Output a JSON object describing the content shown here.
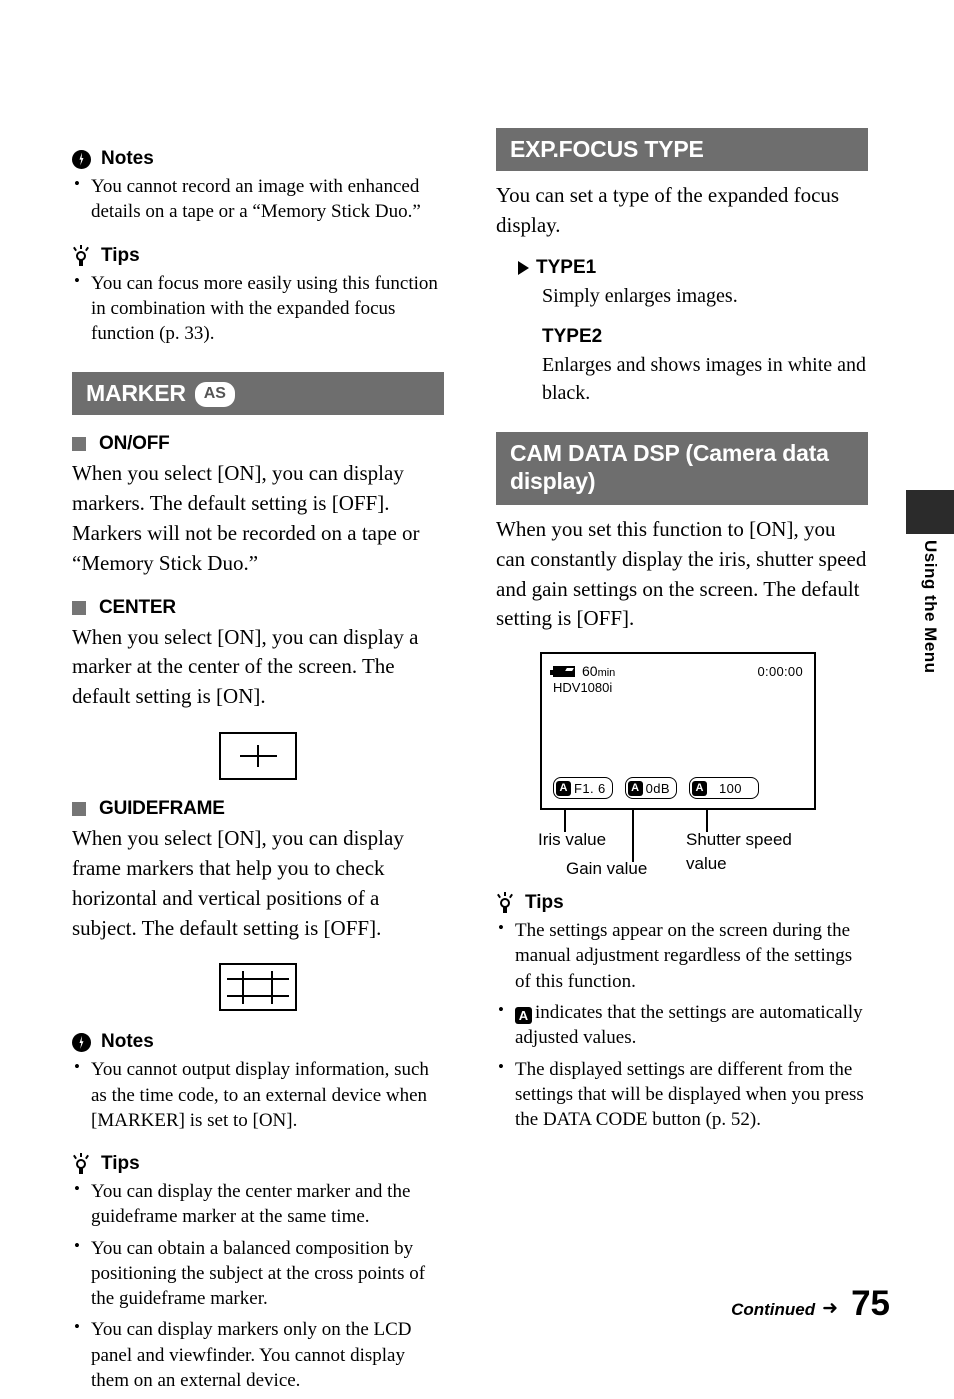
{
  "page": {
    "number": "75",
    "continued_label": "Continued",
    "continued_arrow": "➜",
    "side_tab_label": "Using the Menu"
  },
  "icons": {
    "notes": "notes-lightning-icon",
    "tips": "tips-lightbulb-icon",
    "square_bullet": "gray-square-bullet-icon",
    "triangle": "default-setting-triangle-icon",
    "battery": "battery-icon",
    "auto_badge": "auto-a-badge-icon"
  },
  "colors": {
    "header_bar": "#6e6e6e",
    "square_bullet": "#757575",
    "side_tab": "#2b2b2b"
  },
  "left_column": {
    "notes_top": {
      "heading": "Notes",
      "items": [
        "You cannot record an image with enhanced details on a tape or a “Memory Stick Duo.”"
      ]
    },
    "tips_top": {
      "heading": "Tips",
      "items": [
        "You can focus more easily using this function in combination with the expanded focus function (p. 33)."
      ]
    },
    "marker_section": {
      "title": "MARKER",
      "badge": "AS",
      "subsections": [
        {
          "heading": "ON/OFF",
          "body": "When you select [ON], you can display markers. The default setting is [OFF]. Markers will not be recorded on a tape or “Memory Stick Duo.”"
        },
        {
          "heading": "CENTER",
          "body": "When you select [ON], you can display a marker at the center of the screen. The default setting is [ON].",
          "figure": "center-marker-figure"
        },
        {
          "heading": "GUIDEFRAME",
          "body": "When you select [ON], you can display frame markers that help you to check horizontal and vertical positions of a subject. The default setting is [OFF].",
          "figure": "guideframe-marker-figure"
        }
      ]
    },
    "notes_bottom": {
      "heading": "Notes",
      "items": [
        "You cannot output display information, such as the time code, to an external device when [MARKER] is set to [ON]."
      ]
    },
    "tips_bottom": {
      "heading": "Tips",
      "items": [
        "You can display the center marker and the guideframe marker at the same time.",
        "You can obtain a balanced composition by positioning the subject at the cross points of the guideframe marker.",
        "You can display markers only on the LCD panel and viewfinder. You cannot display them on an external device."
      ]
    }
  },
  "right_column": {
    "exp_focus_section": {
      "title": "EXP.FOCUS TYPE",
      "body": "You can set a type of the expanded focus display.",
      "options": [
        {
          "label": "TYPE1",
          "is_default": true,
          "body": "Simply enlarges images."
        },
        {
          "label": "TYPE2",
          "is_default": false,
          "body": "Enlarges and shows images in white and black."
        }
      ]
    },
    "cam_data_section": {
      "title": "CAM DATA DSP (Camera data display)",
      "body": "When you set this function to [ON], you can constantly display the iris, shutter speed and gain settings on the screen. The default setting is [OFF].",
      "lcd": {
        "battery_minutes": "60",
        "battery_unit": "min",
        "timecode": "0:00:00",
        "format": "HDV1080i",
        "chips": [
          {
            "auto": "A",
            "value": "F1. 6"
          },
          {
            "auto": "A",
            "value": "0dB"
          },
          {
            "auto": "A",
            "value": "100"
          }
        ],
        "callouts": [
          "Iris value",
          "Gain value",
          "Shutter speed",
          "value"
        ]
      }
    },
    "tips": {
      "heading": "Tips",
      "items": [
        {
          "text": "The settings appear on the screen during the manual adjustment regardless of the settings of this function."
        },
        {
          "prefix_icon": "A",
          "text": "indicates that the settings are automatically adjusted values."
        },
        {
          "text": "The displayed settings are different from the settings that will be displayed when you press the DATA CODE button (p. 52)."
        }
      ]
    }
  }
}
